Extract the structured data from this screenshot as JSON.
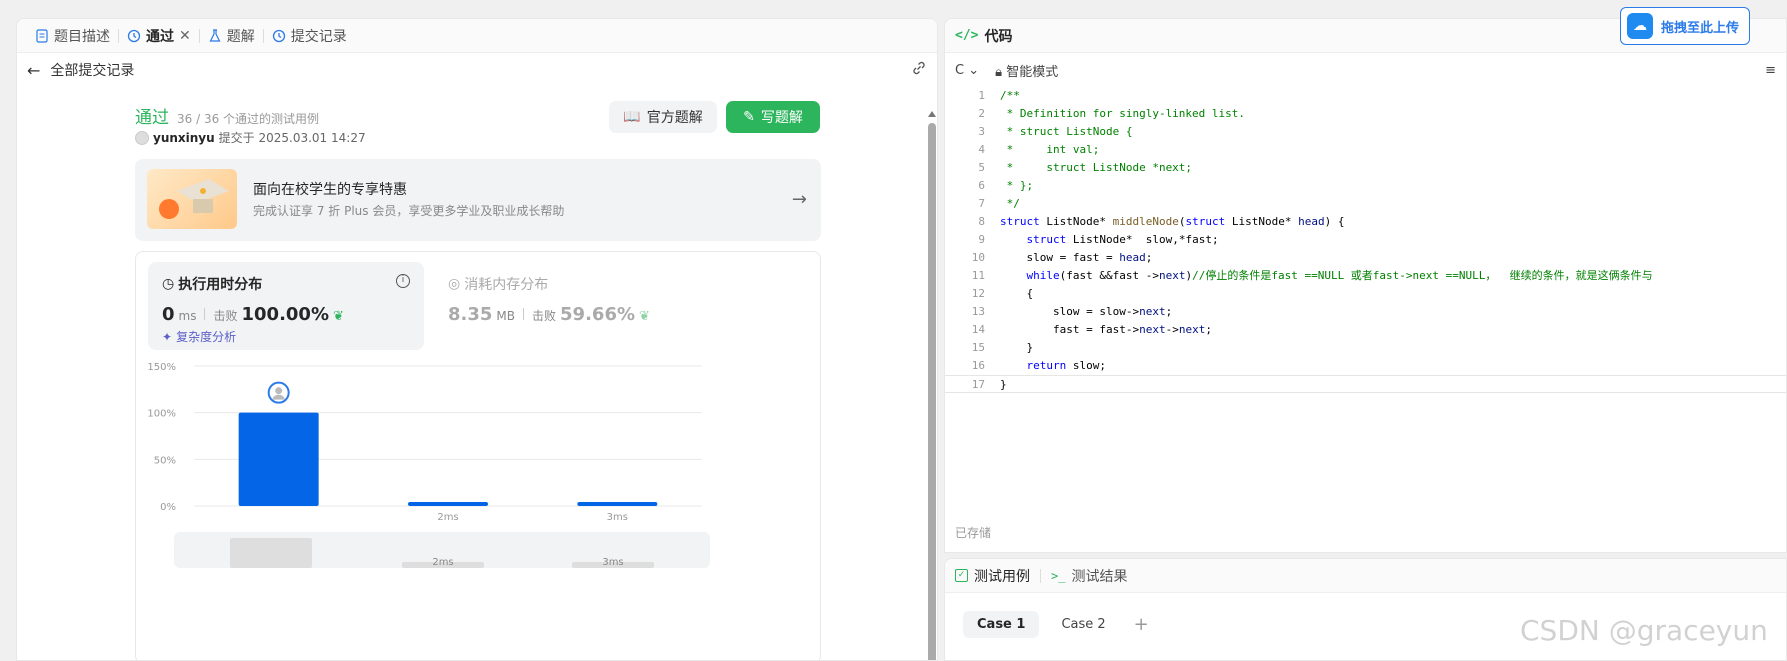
{
  "left_tabs": {
    "description": "题目描述",
    "passed": "通过",
    "solutions": "题解",
    "submissions": "提交记录"
  },
  "subbar": {
    "back_label": "全部提交记录"
  },
  "submission": {
    "status": "通过",
    "testcases": "36 / 36 个通过的测试用例",
    "author": "yunxinyu",
    "submitted_at": "提交于 2025.03.01 14:27",
    "official_solution_label": "官方题解",
    "write_solution_label": "写题解"
  },
  "promo": {
    "title": "面向在校学生的专享特惠",
    "subtitle": "完成认证享 7 折 Plus 会员，享受更多学业及职业成长帮助"
  },
  "runtime": {
    "title": "执行用时分布",
    "value": "0",
    "unit": "ms",
    "beat_label": "击败",
    "beat_value": "100.00%",
    "complexity_label": "复杂度分析"
  },
  "memory": {
    "title": "消耗内存分布",
    "value": "8.35",
    "unit": "MB",
    "beat_label": "击败",
    "beat_value": "59.66%"
  },
  "chart_data": {
    "type": "bar",
    "categories": [
      "",
      "2ms",
      "3ms"
    ],
    "values": [
      100,
      2,
      2
    ],
    "ylim": [
      0,
      150
    ],
    "yticks": [
      "0%",
      "50%",
      "100%",
      "150%"
    ],
    "grid": true,
    "bar_color": "#0466e6",
    "mini_labels": [
      "2ms",
      "3ms"
    ]
  },
  "code_section": {
    "label": "代码",
    "lang": "C"
  },
  "right": {
    "title": "代码",
    "lang": "C",
    "mode": "智能模式",
    "saved": "已存储",
    "upload_badge": "拖拽至此上传"
  },
  "code_lines": [
    "/**",
    " * Definition for singly-linked list.",
    " * struct ListNode {",
    " *     int val;",
    " *     struct ListNode *next;",
    " * };",
    " */",
    "struct ListNode* middleNode(struct ListNode* head) {",
    "    struct ListNode*  slow,*fast;",
    "    slow = fast = head;",
    "    while(fast &&fast ->next)//停止的条件是fast ==NULL 或者fast->next ==NULL，  继续的条件，就是这俩条件与",
    "    {",
    "        slow = slow->next;",
    "        fast = fast->next->next;",
    "    }",
    "    return slow;",
    "}"
  ],
  "testpanel": {
    "tab_cases": "测试用例",
    "tab_results": "测试结果",
    "cases": [
      "Case 1",
      "Case 2"
    ]
  },
  "watermark": "CSDN @graceyun"
}
